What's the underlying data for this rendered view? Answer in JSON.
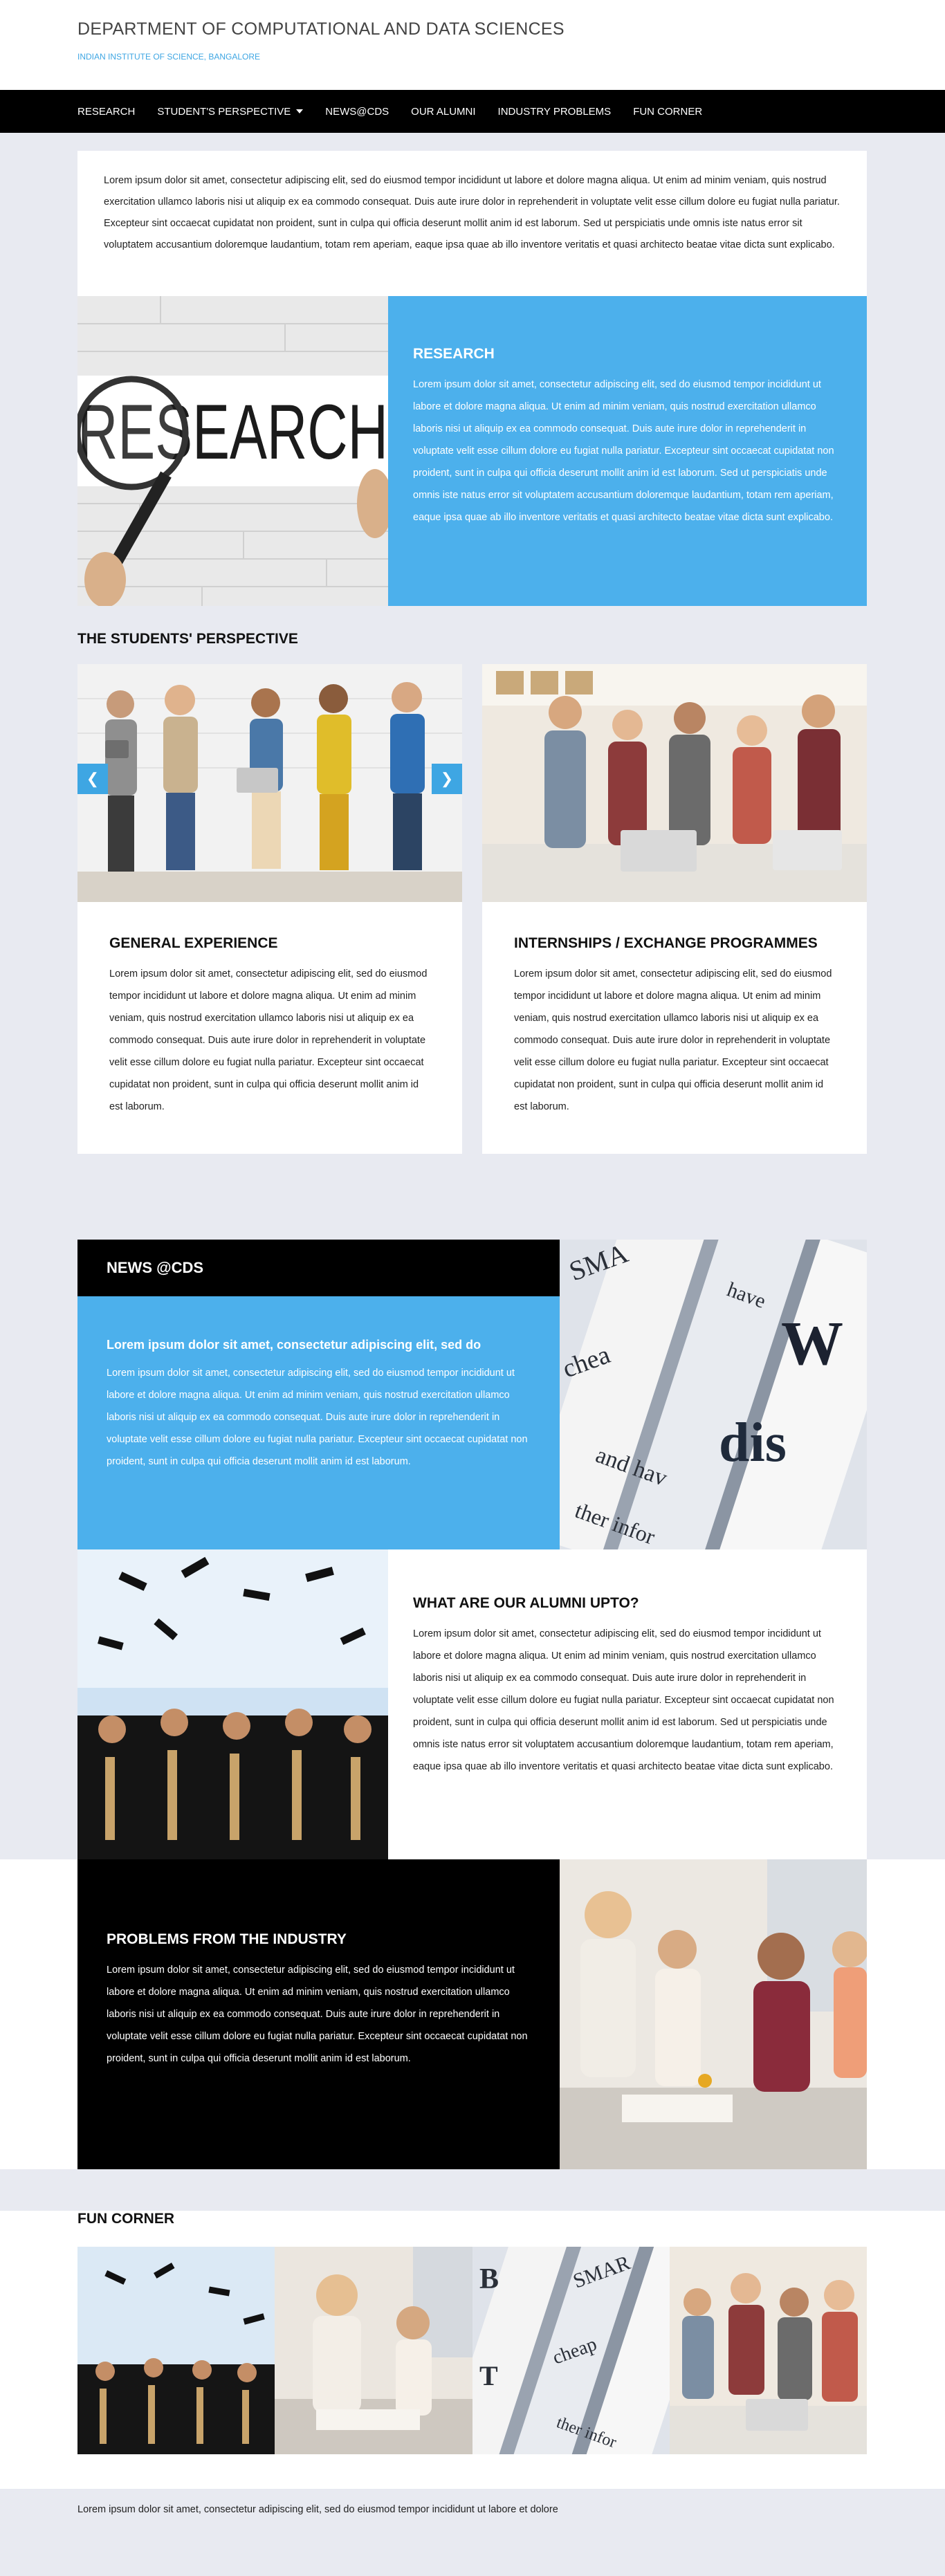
{
  "header": {
    "title": "DEPARTMENT OF COMPUTATIONAL AND DATA SCIENCES",
    "subtitle": "INDIAN INSTITUTE OF SCIENCE, BANGALORE"
  },
  "nav": {
    "items": [
      {
        "label": "RESEARCH"
      },
      {
        "label": "STUDENT'S PERSPECTIVE",
        "has_dropdown": true
      },
      {
        "label": "NEWS@CDS"
      },
      {
        "label": "OUR ALUMNI"
      },
      {
        "label": "INDUSTRY PROBLEMS"
      },
      {
        "label": "FUN CORNER"
      }
    ]
  },
  "intro": {
    "text": "Lorem ipsum dolor sit amet, consectetur adipiscing elit, sed do eiusmod tempor incididunt ut labore et dolore magna aliqua. Ut enim ad minim veniam, quis nostrud exercitation ullamco laboris nisi ut aliquip ex ea commodo consequat. Duis aute irure dolor in reprehenderit in voluptate velit esse cillum dolore eu fugiat nulla pariatur. Excepteur sint occaecat cupidatat non proident, sunt in culpa qui officia deserunt mollit anim id est laborum. Sed ut perspiciatis unde omnis iste natus error sit voluptatem accusantium doloremque laudantium, totam rem aperiam, eaque ipsa quae ab illo inventore veritatis et quasi architecto beatae vitae dicta sunt explicabo."
  },
  "research": {
    "image_word": "RESEARCH",
    "title": "RESEARCH",
    "text": "Lorem ipsum dolor sit amet, consectetur adipiscing elit, sed do eiusmod tempor incididunt ut labore et dolore magna aliqua. Ut enim ad minim veniam, quis nostrud exercitation ullamco laboris nisi ut aliquip ex ea commodo consequat. Duis aute irure dolor in reprehenderit in voluptate velit esse cillum dolore eu fugiat nulla pariatur. Excepteur sint occaecat cupidatat non proident, sunt in culpa qui officia deserunt mollit anim id est laborum. Sed ut perspiciatis unde omnis iste natus error sit voluptatem accusantium doloremque laudantium, totam rem aperiam, eaque ipsa quae ab illo inventore veritatis et quasi architecto beatae vitae dicta sunt explicabo."
  },
  "students": {
    "heading": "THE STUDENTS' PERSPECTIVE",
    "cards": [
      {
        "title": "GENERAL EXPERIENCE",
        "text": "Lorem ipsum dolor sit amet, consectetur adipiscing elit, sed do eiusmod tempor incididunt ut labore et dolore magna aliqua. Ut enim ad minim veniam, quis nostrud exercitation ullamco laboris nisi ut aliquip ex ea commodo consequat. Duis aute irure dolor in reprehenderit in voluptate velit esse cillum dolore eu fugiat nulla pariatur. Excepteur sint occaecat cupidatat non proident, sunt in culpa qui officia deserunt mollit anim id est laborum."
      },
      {
        "title": "INTERNSHIPS / EXCHANGE PROGRAMMES",
        "text": "Lorem ipsum dolor sit amet, consectetur adipiscing elit, sed do eiusmod tempor incididunt ut labore et dolore magna aliqua. Ut enim ad minim veniam, quis nostrud exercitation ullamco laboris nisi ut aliquip ex ea commodo consequat. Duis aute irure dolor in reprehenderit in voluptate velit esse cillum dolore eu fugiat nulla pariatur. Excepteur sint occaecat cupidatat non proident, sunt in culpa qui officia deserunt mollit anim id est laborum."
      }
    ],
    "arrow_left": "❮",
    "arrow_right": "❯"
  },
  "news": {
    "title": "NEWS @CDS",
    "subtitle": "Lorem ipsum dolor sit amet, consectetur adipiscing elit, sed do",
    "text": "Lorem ipsum dolor sit amet, consectetur adipiscing elit, sed do eiusmod tempor incididunt ut labore et dolore magna aliqua. Ut enim ad minim veniam, quis nostrud exercitation ullamco laboris nisi ut aliquip ex ea commodo consequat. Duis aute irure dolor in reprehenderit in voluptate velit esse cillum dolore eu fugiat nulla pariatur. Excepteur sint occaecat cupidatat non proident, sunt in culpa qui officia deserunt mollit anim id est laborum."
  },
  "alumni": {
    "title": "WHAT ARE OUR ALUMNI UPTO?",
    "text": "Lorem ipsum dolor sit amet, consectetur adipiscing elit, sed do eiusmod tempor incididunt ut labore et dolore magna aliqua. Ut enim ad minim veniam, quis nostrud exercitation ullamco laboris nisi ut aliquip ex ea commodo consequat. Duis aute irure dolor in reprehenderit in voluptate velit esse cillum dolore eu fugiat nulla pariatur. Excepteur sint occaecat cupidatat non proident, sunt in culpa qui officia deserunt mollit anim id est laborum. Sed ut perspiciatis unde omnis iste natus error sit voluptatem accusantium doloremque laudantium, totam rem aperiam, eaque ipsa quae ab illo inventore veritatis et quasi architecto beatae vitae dicta sunt explicabo."
  },
  "industry": {
    "title": "PROBLEMS FROM THE INDUSTRY",
    "text": "Lorem ipsum dolor sit amet, consectetur adipiscing elit, sed do eiusmod tempor incididunt ut labore et dolore magna aliqua. Ut enim ad minim veniam, quis nostrud exercitation ullamco laboris nisi ut aliquip ex ea commodo consequat. Duis aute irure dolor in reprehenderit in voluptate velit esse cillum dolore eu fugiat nulla pariatur. Excepteur sint occaecat cupidatat non proident, sunt in culpa qui officia deserunt mollit anim id est laborum."
  },
  "fun": {
    "heading": "FUN CORNER"
  },
  "footer": {
    "text": "Lorem ipsum dolor sit amet, consectetur adipiscing elit, sed do eiusmod tempor incididunt ut labore et dolore"
  },
  "colors": {
    "accent_blue": "#4cb0ec",
    "nav_bg": "#000000",
    "page_bg": "#e8eaf1"
  }
}
